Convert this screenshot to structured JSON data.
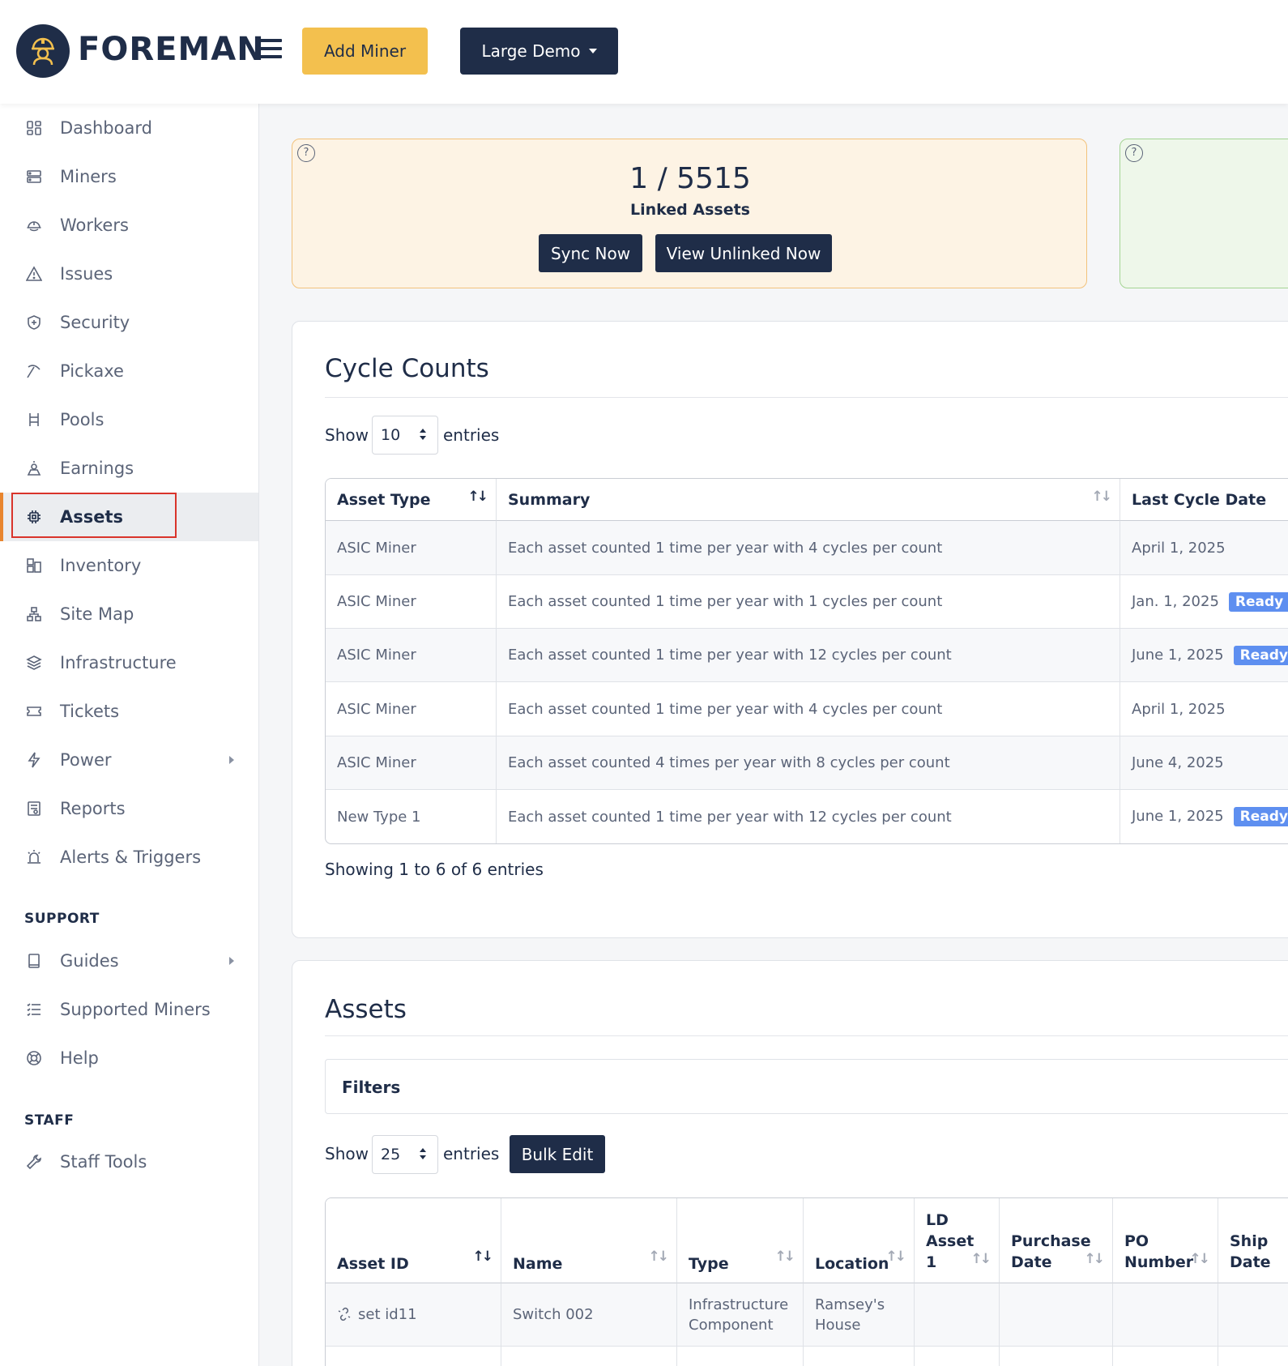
{
  "header": {
    "brand": "FOREMAN",
    "add_miner": "Add Miner",
    "org_selector": "Large Demo"
  },
  "sidebar": {
    "items": [
      {
        "label": "Dashboard",
        "icon": "dashboard-icon"
      },
      {
        "label": "Miners",
        "icon": "server-icon"
      },
      {
        "label": "Workers",
        "icon": "hard-hat-icon"
      },
      {
        "label": "Issues",
        "icon": "warning-icon"
      },
      {
        "label": "Security",
        "icon": "shield-icon"
      },
      {
        "label": "Pickaxe",
        "icon": "pickaxe-icon"
      },
      {
        "label": "Pools",
        "icon": "pools-icon"
      },
      {
        "label": "Earnings",
        "icon": "earnings-icon"
      },
      {
        "label": "Assets",
        "icon": "chip-icon",
        "active": true
      },
      {
        "label": "Inventory",
        "icon": "inventory-icon"
      },
      {
        "label": "Site Map",
        "icon": "sitemap-icon"
      },
      {
        "label": "Infrastructure",
        "icon": "layers-icon"
      },
      {
        "label": "Tickets",
        "icon": "ticket-icon"
      },
      {
        "label": "Power",
        "icon": "bolt-icon",
        "expandable": true
      },
      {
        "label": "Reports",
        "icon": "report-icon"
      },
      {
        "label": "Alerts & Triggers",
        "icon": "alarm-icon"
      }
    ],
    "support_heading": "SUPPORT",
    "support_items": [
      {
        "label": "Guides",
        "icon": "book-icon",
        "expandable": true
      },
      {
        "label": "Supported Miners",
        "icon": "list-icon"
      },
      {
        "label": "Help",
        "icon": "lifebuoy-icon"
      }
    ],
    "staff_heading": "STAFF",
    "staff_items": [
      {
        "label": "Staff Tools",
        "icon": "tools-icon"
      }
    ]
  },
  "linked_card": {
    "help": "?",
    "count": "1 / 5515",
    "label": "Linked Assets",
    "sync_button": "Sync Now",
    "view_button": "View Unlinked Now"
  },
  "green_card": {
    "help": "?"
  },
  "cycle_counts": {
    "title": "Cycle Counts",
    "show_label": "Show",
    "entries_value": "10",
    "entries_label": "entries",
    "columns": [
      "Asset Type",
      "Summary",
      "Last Cycle Date"
    ],
    "rows": [
      {
        "type": "ASIC Miner",
        "summary": "Each asset counted 1 time per year with 4 cycles per count",
        "date": "April 1, 2025",
        "badge": ""
      },
      {
        "type": "ASIC Miner",
        "summary": "Each asset counted 1 time per year with 1 cycles per count",
        "date": "Jan. 1, 2025",
        "badge": "Ready T"
      },
      {
        "type": "ASIC Miner",
        "summary": "Each asset counted 1 time per year with 12 cycles per count",
        "date": "June 1, 2025",
        "badge": "Ready"
      },
      {
        "type": "ASIC Miner",
        "summary": "Each asset counted 1 time per year with 4 cycles per count",
        "date": "April 1, 2025",
        "badge": ""
      },
      {
        "type": "ASIC Miner",
        "summary": "Each asset counted 4 times per year with 8 cycles per count",
        "date": "June 4, 2025",
        "badge": ""
      },
      {
        "type": "New Type 1",
        "summary": "Each asset counted 1 time per year with 12 cycles per count",
        "date": "June 1, 2025",
        "badge": "Ready"
      }
    ],
    "footer": "Showing 1 to 6 of 6 entries"
  },
  "assets": {
    "title": "Assets",
    "filters_label": "Filters",
    "show_label": "Show",
    "entries_value": "25",
    "entries_label": "entries",
    "bulk_edit": "Bulk Edit",
    "columns": {
      "asset_id": "Asset ID",
      "name": "Name",
      "type": "Type",
      "location": "Location",
      "ld_asset": "LD Asset 1",
      "purchase_date": "Purchase Date",
      "po_number": "PO Number",
      "ship_date": "Ship Date"
    },
    "rows": [
      {
        "asset_id": "set id11",
        "name": "Switch 002",
        "type": "Infrastructure Component",
        "location": "Ramsey's House",
        "ld_asset": "",
        "purchase_date": "",
        "po_number": "",
        "ship_date": ""
      }
    ]
  },
  "colors": {
    "navy": "#1f2d48",
    "accent_yellow": "#f3c04e",
    "active_bar": "#e8852e",
    "badge_blue": "#5e8ff0",
    "highlight_red": "#d9342b"
  }
}
